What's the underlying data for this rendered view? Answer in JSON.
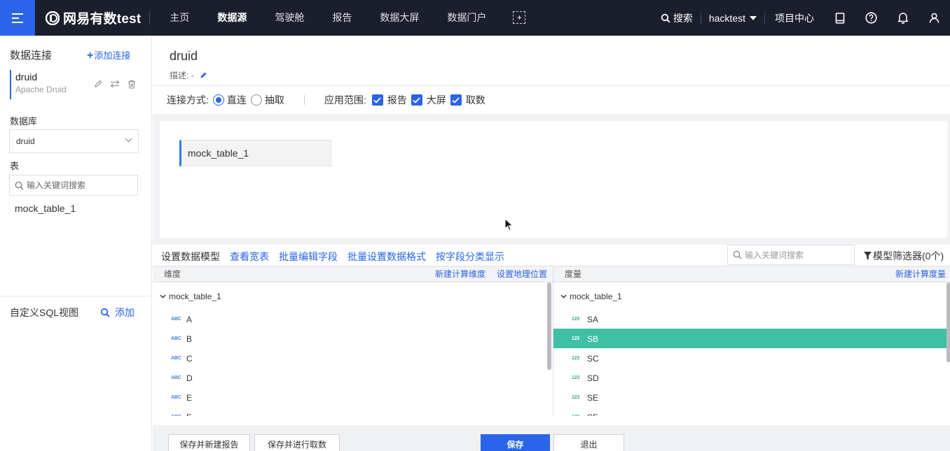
{
  "topbar": {
    "brand": "网易有数test",
    "nav": [
      "主页",
      "数据源",
      "驾驶舱",
      "报告",
      "数据大屏",
      "数据门户"
    ],
    "active_nav": "数据源",
    "search_label": "搜索",
    "user": "hacktest",
    "project_center": "项目中心"
  },
  "left": {
    "title": "数据连接",
    "add_label": "添加连接",
    "connection": {
      "name": "druid",
      "type": "Apache Druid"
    },
    "db_label": "数据库",
    "db_value": "druid",
    "table_label": "表",
    "table_search_placeholder": "输入关键词搜索",
    "tables": [
      "mock_table_1"
    ],
    "custom_sql_label": "自定义SQL视图",
    "custom_sql_add": "添加"
  },
  "main": {
    "title": "druid",
    "desc_label": "描述: -",
    "conn_mode_label": "连接方式:",
    "mode_direct": "直连",
    "mode_extract": "抽取",
    "scope_label": "应用范围:",
    "scope_items": [
      "报告",
      "大屏",
      "取数"
    ],
    "canvas_table": "mock_table_1"
  },
  "toolbar": {
    "model_label": "设置数据模型",
    "links": [
      "查看宽表",
      "批量编辑字段",
      "批量设置数据格式",
      "按字段分类显示"
    ],
    "search_placeholder": "输入关键词搜索",
    "filter_label": "模型筛选器(0个)"
  },
  "dimensions": {
    "header": "维度",
    "action_1": "新建计算维度",
    "action_2": "设置地理位置",
    "group": "mock_table_1",
    "type_label": "ABC",
    "fields": [
      "A",
      "B",
      "C",
      "D",
      "E",
      "F"
    ]
  },
  "measures": {
    "header": "度量",
    "action_1": "新建计算度量",
    "group": "mock_table_1",
    "type_label": "123",
    "fields": [
      "SA",
      "SB",
      "SC",
      "SD",
      "SE",
      "SF"
    ],
    "selected": "SB"
  },
  "footer": {
    "btn_save_new_report": "保存并新建报告",
    "btn_save_query": "保存并进行取数",
    "btn_save": "保存",
    "btn_exit": "退出"
  },
  "colors": {
    "accent": "#2a64e8",
    "topbar": "#1b1e2b",
    "selected_row": "#3fc0a4"
  }
}
